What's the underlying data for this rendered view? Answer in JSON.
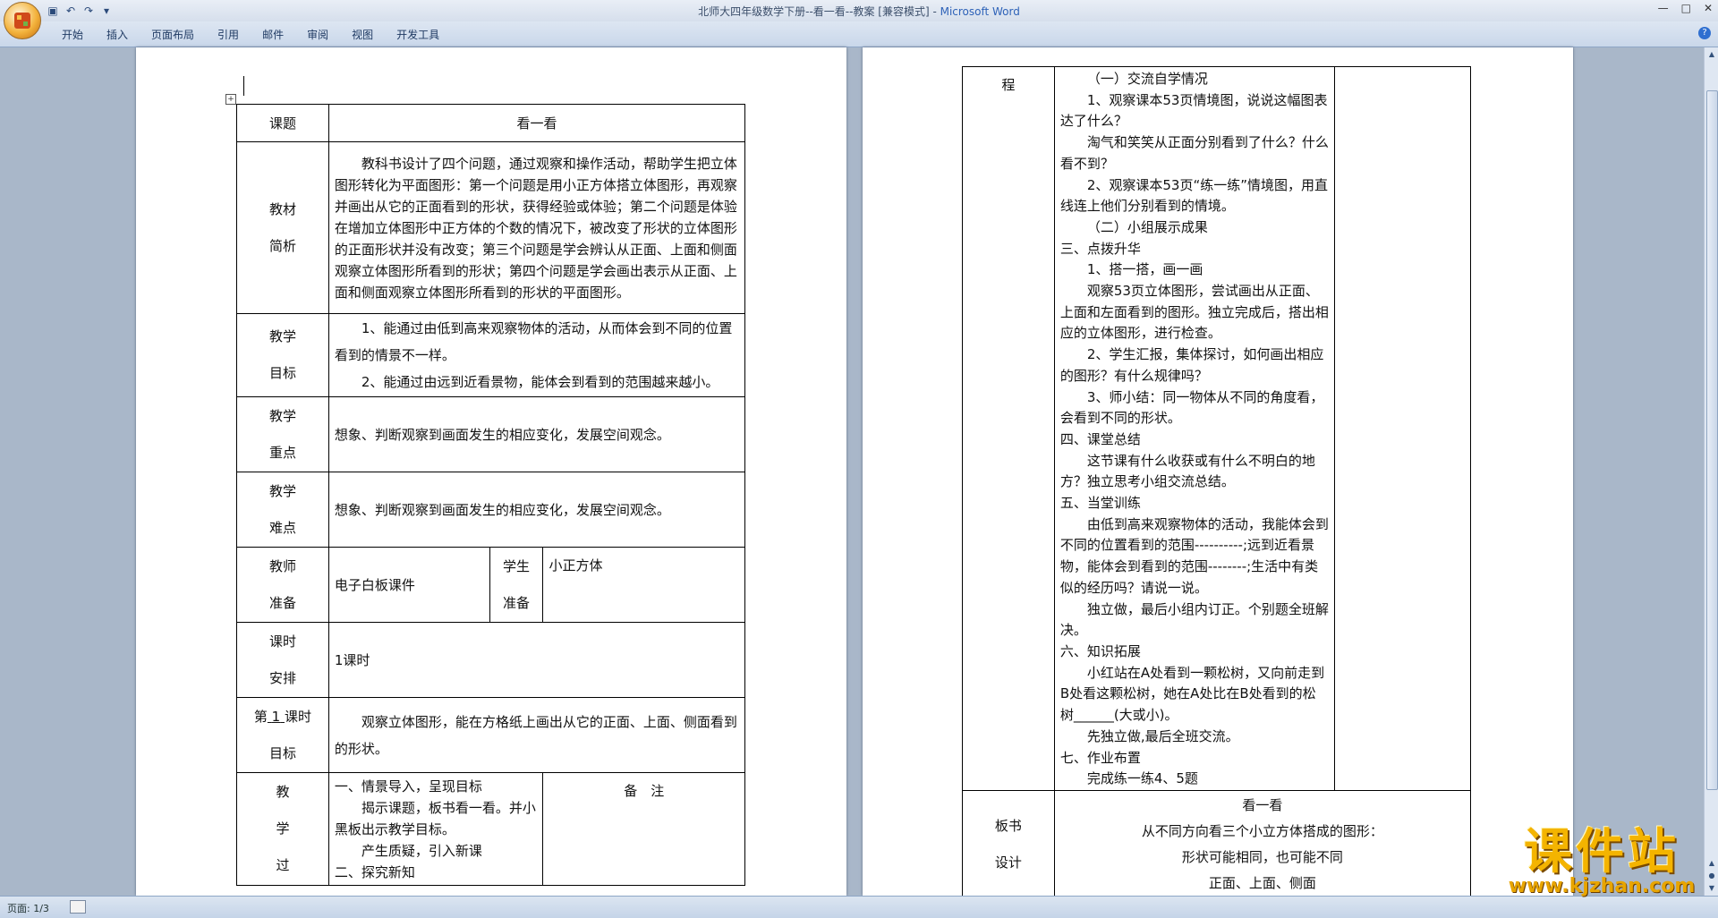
{
  "window": {
    "title": "北师大四年级数学下册--看一看--教案 [兼容模式] - ",
    "app_name": "Microsoft Word"
  },
  "qat": {
    "icons": [
      "save-icon",
      "undo-icon",
      "redo-icon",
      "customize-icon"
    ]
  },
  "ribbon": {
    "tabs": [
      "开始",
      "插入",
      "页面布局",
      "引用",
      "邮件",
      "审阅",
      "视图",
      "开发工具"
    ]
  },
  "status": {
    "page": "页面: 1/3"
  },
  "page1": {
    "topic_label": "课题",
    "topic_value": "看一看",
    "material_label_1": "教材",
    "material_label_2": "简析",
    "material_text": "教科书设计了四个问题，通过观察和操作活动，帮助学生把立体图形转化为平面图形：第一个问题是用小正方体搭立体图形，再观察并画出从它的正面看到的形状，获得经验或体验；第二个问题是体验在增加立体图形中正方体的个数的情况下，被改变了形状的立体图形的正面形状并没有改变；第三个问题是学会辨认从正面、上面和侧面观察立体图形所看到的形状；第四个问题是学会画出表示从正面、上面和侧面观察立体图形所看到的形状的平面图形。",
    "goal_label_1": "教学",
    "goal_label_2": "目标",
    "goal_1": "1、能通过由低到高来观察物体的活动，从而体会到不同的位置看到的情景不一样。",
    "goal_2": "2、能通过由远到近看景物，能体会到看到的范围越来越小。",
    "key_label_1": "教学",
    "key_label_2": "重点",
    "key_text": "想象、判断观察到画面发生的相应变化，发展空间观念。",
    "diff_label_1": "教学",
    "diff_label_2": "难点",
    "diff_text": "想象、判断观察到画面发生的相应变化，发展空间观念。",
    "teacher_label_1": "教师",
    "teacher_label_2": "准备",
    "teacher_text": "电子白板课件",
    "student_label_1": "学生",
    "student_label_2": "准备",
    "student_text": "小正方体",
    "time_label_1": "课时",
    "time_label_2": "安排",
    "time_text": "1课时",
    "lesson_label_pre": "第",
    "lesson_label_num": "1",
    "lesson_label_post": "课时",
    "lesson_label_2": "目标",
    "lesson_text": "观察立体图形，能在方格纸上画出从它的正面、上面、侧面看到的形状。",
    "process_label_1": "教",
    "process_label_2": "学",
    "process_label_3": "过",
    "process_lines": [
      "一、情景导入，呈现目标",
      "揭示课题，板书看一看。并小黑板出示教学目标。",
      "产生质疑，引入新课",
      "二、探究新知"
    ],
    "remark_label": "备　注"
  },
  "page2": {
    "process_label": "程",
    "lines": [
      "（一）交流自学情况",
      "1、观察课本53页情境图，说说这幅图表达了什么？",
      "淘气和笑笑从正面分别看到了什么？什么看不到？",
      "2、观察课本53页“练一练”情境图，用直线连上他们分别看到的情境。",
      "（二）小组展示成果",
      "三、点拨升华",
      "1、搭一搭，画一画",
      "观察53页立体图形，尝试画出从正面、上面和左面看到的图形。独立完成后，搭出相应的立体图形，进行检查。",
      "2、学生汇报，集体探讨，如何画出相应的图形？有什么规律吗？",
      "3、师小结：同一物体从不同的角度看，会看到不同的形状。",
      "四、课堂总结",
      "这节课有什么收获或有什么不明白的地方？独立思考小组交流总结。",
      "五、当堂训练",
      "由低到高来观察物体的活动，我能体会到不同的位置看到的范围----------;远到近看景物，能体会到看到的范围--------;生活中有类似的经历吗？请说一说。",
      "独立做，最后小组内订正。个别题全班解决。",
      "六、知识拓展",
      "小红站在A处看到一颗松树，又向前走到B处看这颗松树，她在A处比在B处看到的松树______(大或小)。",
      "先独立做,最后全班交流。",
      "七、作业布置",
      "完成练一练4、5题"
    ],
    "board_label_1": "板书",
    "board_label_2": "设计",
    "board_lines": [
      "看一看",
      "从不同方向看三个小立方体搭成的图形：",
      "形状可能相同，也可能不同",
      "正面、上面、侧面"
    ]
  },
  "watermark": {
    "title": "课件站",
    "url": "www.kjzhan.com"
  }
}
